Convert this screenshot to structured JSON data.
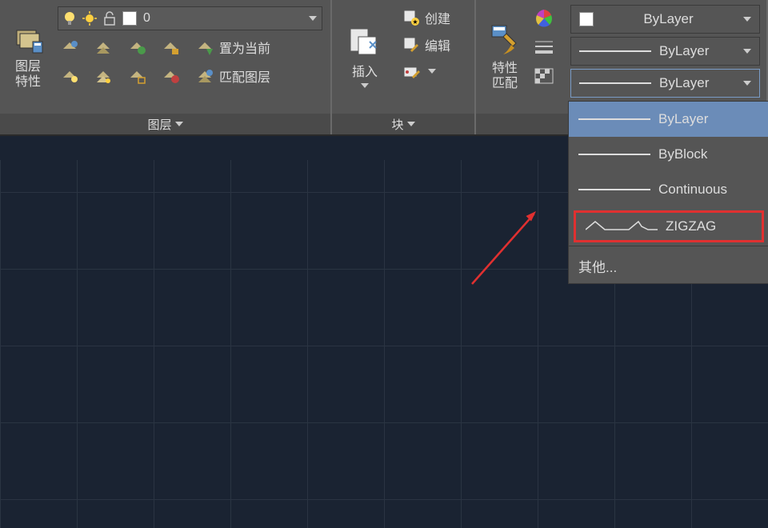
{
  "layers": {
    "panel_title": "图层",
    "big_label": "图层\n特性",
    "dropdown_value": "0",
    "set_current": "置为当前",
    "match_layer": "匹配图层"
  },
  "blocks": {
    "panel_title": "块",
    "insert": "插入",
    "create": "创建",
    "edit": "编辑"
  },
  "properties": {
    "big_label": "特性\n匹配",
    "dd1": "ByLayer",
    "dd2": "ByLayer",
    "dd3": "ByLayer"
  },
  "linetype_menu": {
    "items": [
      {
        "label": "ByLayer",
        "selected": true
      },
      {
        "label": "ByBlock"
      },
      {
        "label": "Continuous"
      },
      {
        "label": "ZIGZAG",
        "highlight": true,
        "zig": true
      }
    ],
    "other": "其他..."
  }
}
